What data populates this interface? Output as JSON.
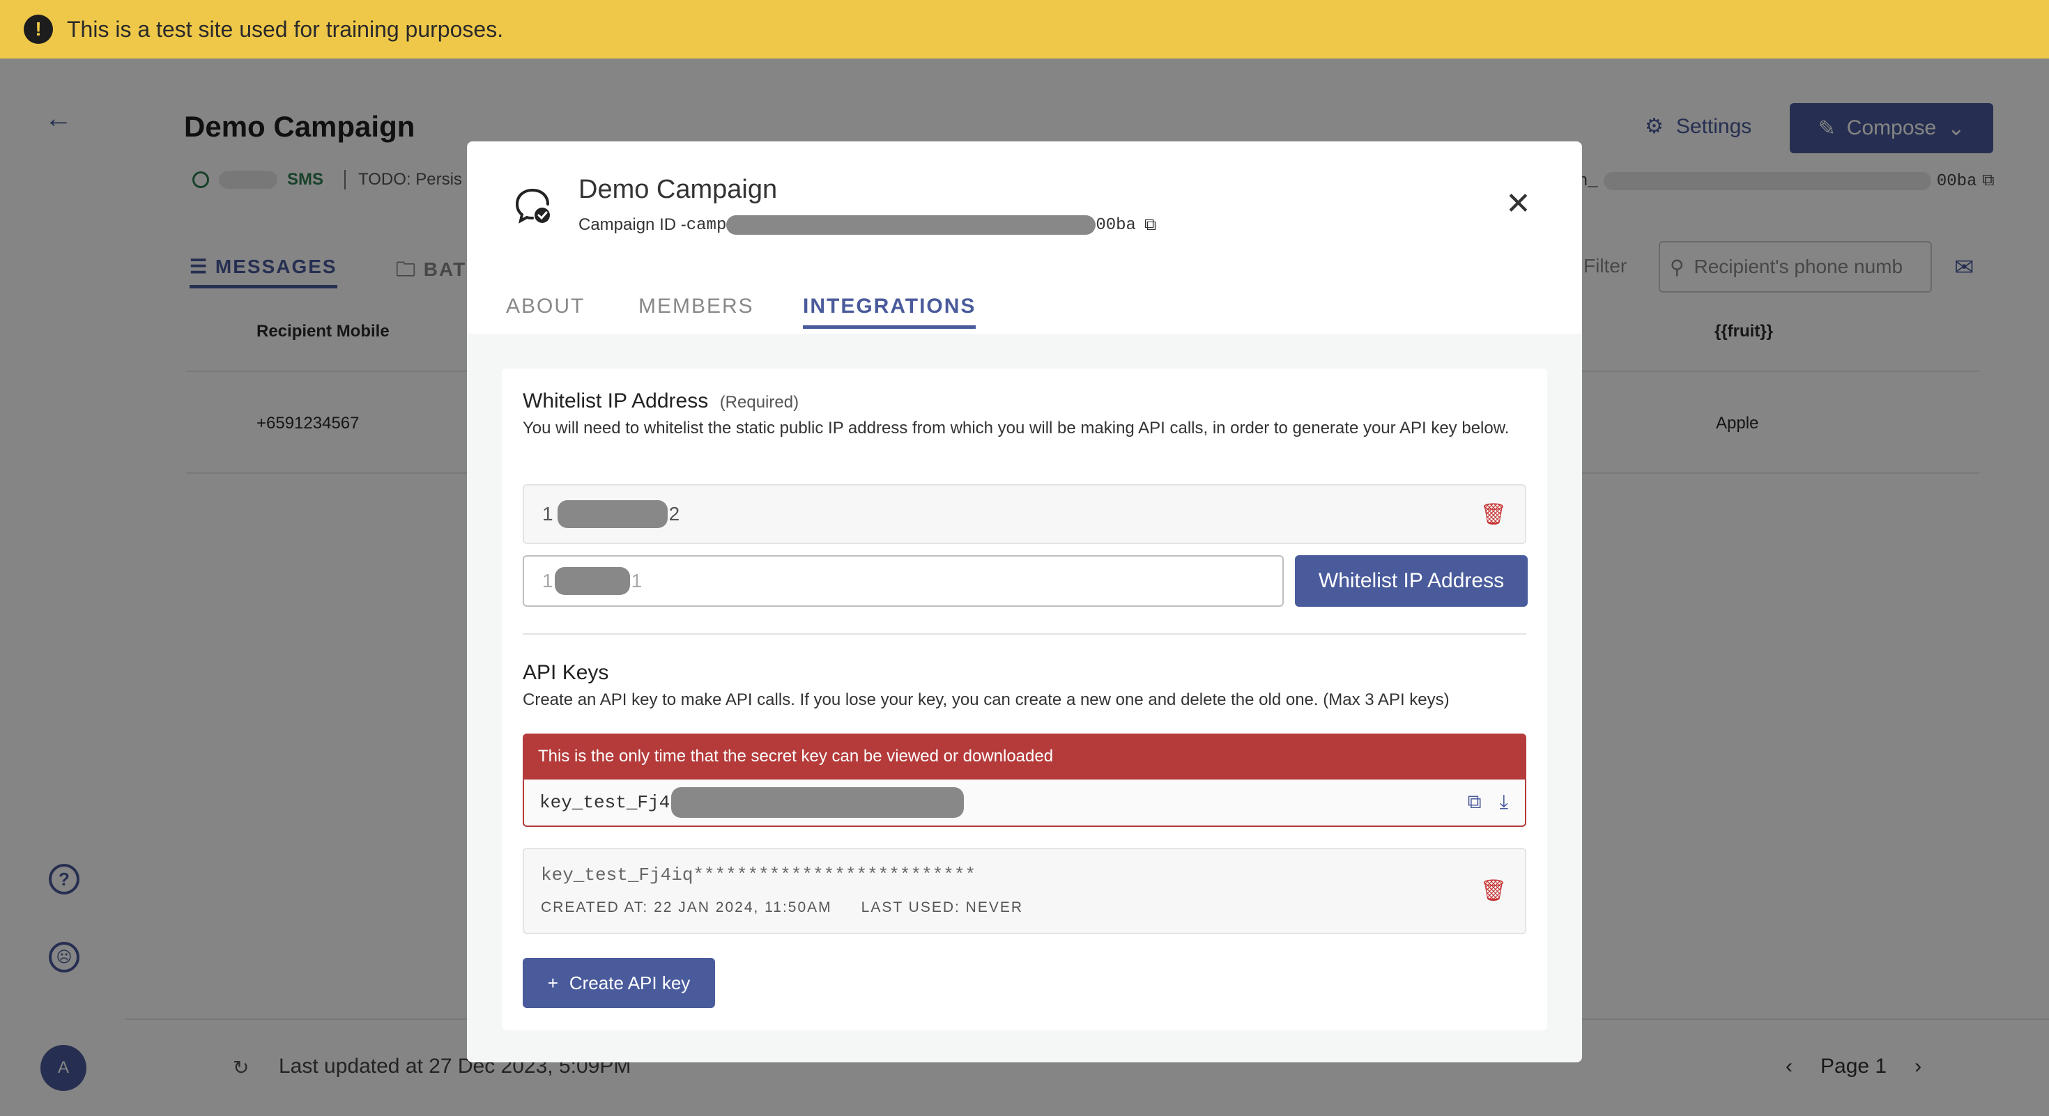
{
  "banner": {
    "text": "This is a test site used for training purposes."
  },
  "page": {
    "title": "Demo Campaign",
    "channel": "SMS",
    "todo": "TODO: Persis",
    "settings_label": "Settings",
    "compose_label": "Compose",
    "campaign_id_tail": "00ba",
    "campaign_id_prefix": "n_",
    "tabs": [
      {
        "label": "MESSAGES"
      },
      {
        "label": "BAT"
      }
    ],
    "filter_label": "Filter",
    "search_placeholder": "Recipient's phone numb",
    "table": {
      "headers": {
        "mobile": "Recipient Mobile",
        "fruit": "{{fruit}}"
      },
      "rows": [
        {
          "mobile": "+6591234567",
          "fruit": "Apple"
        }
      ]
    },
    "footer": {
      "updated": "Last updated at 27 Dec 2023, 5:09PM",
      "page": "Page 1"
    },
    "avatar": "A"
  },
  "modal": {
    "title": "Demo Campaign",
    "campaign_id_label": "Campaign ID - ",
    "campaign_id_start": "camp",
    "campaign_id_end": "00ba",
    "tabs": [
      {
        "label": "ABOUT",
        "active": false
      },
      {
        "label": "MEMBERS",
        "active": false
      },
      {
        "label": "INTEGRATIONS",
        "active": true
      }
    ],
    "whitelist": {
      "title": "Whitelist IP Address",
      "required": "(Required)",
      "desc": "You will need to whitelist the static public IP address from which you will be making API calls, in order to generate your API key below.",
      "existing_ip_start": "1",
      "existing_ip_end": "2",
      "input_ip_start": "1",
      "input_ip_end": "1",
      "button": "Whitelist IP Address"
    },
    "api_keys": {
      "title": "API Keys",
      "desc": "Create an API key to make API calls. If you lose your key, you can create a new one and delete the old one. (Max 3 API keys)",
      "alert": "This is the only time that the secret key can be viewed or downloaded",
      "secret_prefix": "key_test_Fj4",
      "masked_key": "key_test_Fj4iq**************************",
      "created_at": "CREATED AT: 22 JAN 2024, 11:50AM",
      "last_used": "LAST USED: NEVER",
      "create_button": "Create API key"
    }
  },
  "colors": {
    "primary": "#4a5b9c",
    "banner": "#efc84a",
    "danger": "#b53b3b"
  }
}
